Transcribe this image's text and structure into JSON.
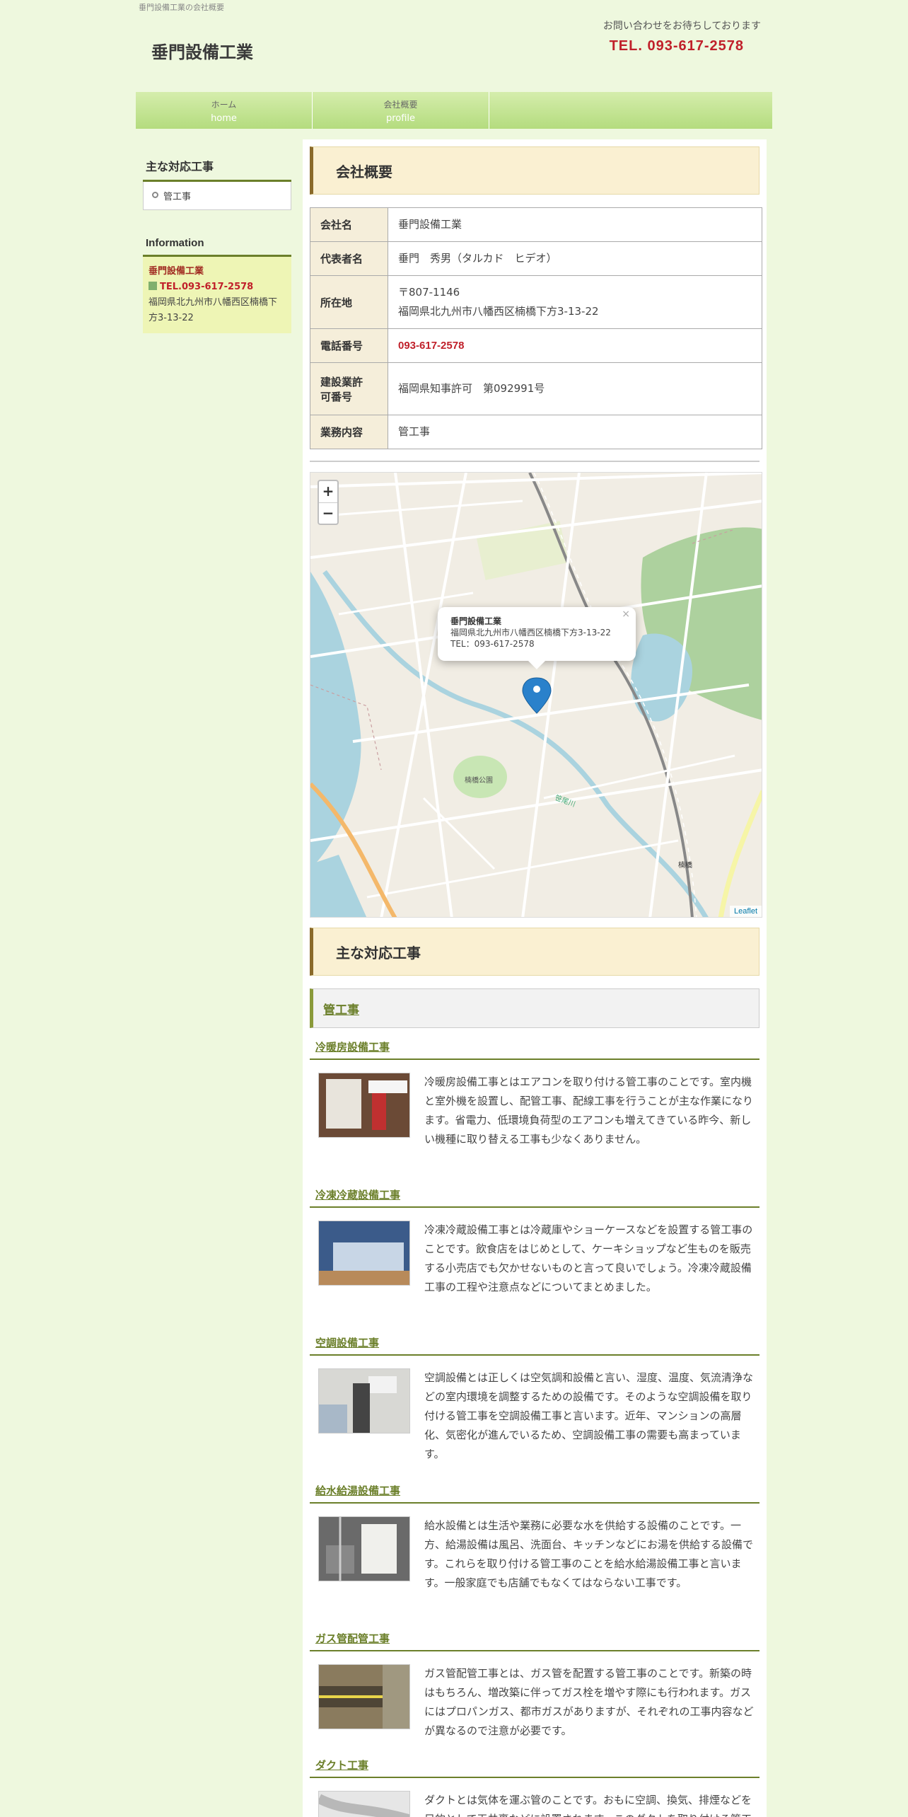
{
  "header": {
    "tagline": "垂門設備工業の会社概要",
    "logo": "垂門設備工業",
    "contact_note": "お問い合わせをお待ちしております",
    "tel": "TEL. 093-617-2578"
  },
  "nav": [
    {
      "jp": "ホーム",
      "en": "home"
    },
    {
      "jp": "会社概要",
      "en": "profile"
    }
  ],
  "sidebar": {
    "services_title": "主な対応工事",
    "services_item": "管工事",
    "info_title": "Information",
    "info_name": "垂門設備工業",
    "info_tel": "TEL.093-617-2578",
    "info_address": "福岡県北九州市八幡西区楠橋下方3-13-22"
  },
  "profile": {
    "title": "会社概要",
    "rows": [
      {
        "label": "会社名",
        "value": "垂門設備工業"
      },
      {
        "label": "代表者名",
        "value": "垂門　秀男（タルカド　ヒデオ）"
      },
      {
        "label": "所在地",
        "value": "〒807-1146",
        "value2": "福岡県北九州市八幡西区楠橋下方3-13-22"
      },
      {
        "label": "電話番号",
        "value": "093-617-2578"
      },
      {
        "label": "建設業許",
        "label2": "可番号",
        "value": "福岡県知事許可　第092991号"
      },
      {
        "label": "業務内容",
        "value": "管工事"
      }
    ]
  },
  "map": {
    "zoom_in": "+",
    "zoom_out": "−",
    "popup_name": "垂門設備工業",
    "popup_address": "福岡県北九州市八幡西区楠橋下方3-13-22",
    "popup_tel": "TEL：093-617-2578",
    "popup_close": "×",
    "park_label": "楠橋公園",
    "station_label": "楠橋",
    "river_label": "笹尾川",
    "attribution": "Leaflet"
  },
  "services": {
    "title": "主な対応工事",
    "category": "管工事",
    "items": [
      {
        "title": "冷暖房設備工事",
        "text": "冷暖房設備工事とはエアコンを取り付ける管工事のことです。室内機と室外機を設置し、配管工事、配線工事を行うことが主な作業になります。省電力、低環境負荷型のエアコンも増えてきている昨今、新しい機種に取り替える工事も少なくありません。"
      },
      {
        "title": "冷凍冷蔵設備工事",
        "text": "冷凍冷蔵設備工事とは冷蔵庫やショーケースなどを設置する管工事のことです。飲食店をはじめとして、ケーキショップなど生ものを販売する小売店でも欠かせないものと言って良いでしょう。冷凍冷蔵設備工事の工程や注意点などについてまとめました。"
      },
      {
        "title": "空調設備工事",
        "text": "空調設備とは正しくは空気調和設備と言い、湿度、温度、気流清浄などの室内環境を調整するための設備です。そのような空調設備を取り付ける管工事を空調設備工事と言います。近年、マンションの高層化、気密化が進んでいるため、空調設備工事の需要も高まっています。"
      },
      {
        "title": "給水給湯設備工事",
        "text": "給水設備とは生活や業務に必要な水を供給する設備のことです。一方、給湯設備は風呂、洗面台、キッチンなどにお湯を供給する設備です。これらを取り付ける管工事のことを給水給湯設備工事と言います。一般家庭でも店舗でもなくてはならない工事です。"
      },
      {
        "title": "ガス管配管工事",
        "text": "ガス管配管工事とは、ガス管を配置する管工事のことです。新築の時はもちろん、増改築に伴ってガス栓を増やす際にも行われます。ガスにはプロパンガス、都市ガスがありますが、それぞれの工事内容などが異なるので注意が必要です。"
      },
      {
        "title": "ダクト工事",
        "text": "ダクトとは気体を運ぶ管のことです。おもに空調、換気、排煙などを目的として天井裏などに設置されます。このダクトを取り付ける管工事のことをダクト工事といいます。ダクトにはさまざまな種類があり、目的に応じて的確に選択しなければいけ"
      }
    ]
  },
  "colors": {
    "accent": "#6b7f2a",
    "tel": "#c0202a",
    "bg": "#eef8de"
  }
}
